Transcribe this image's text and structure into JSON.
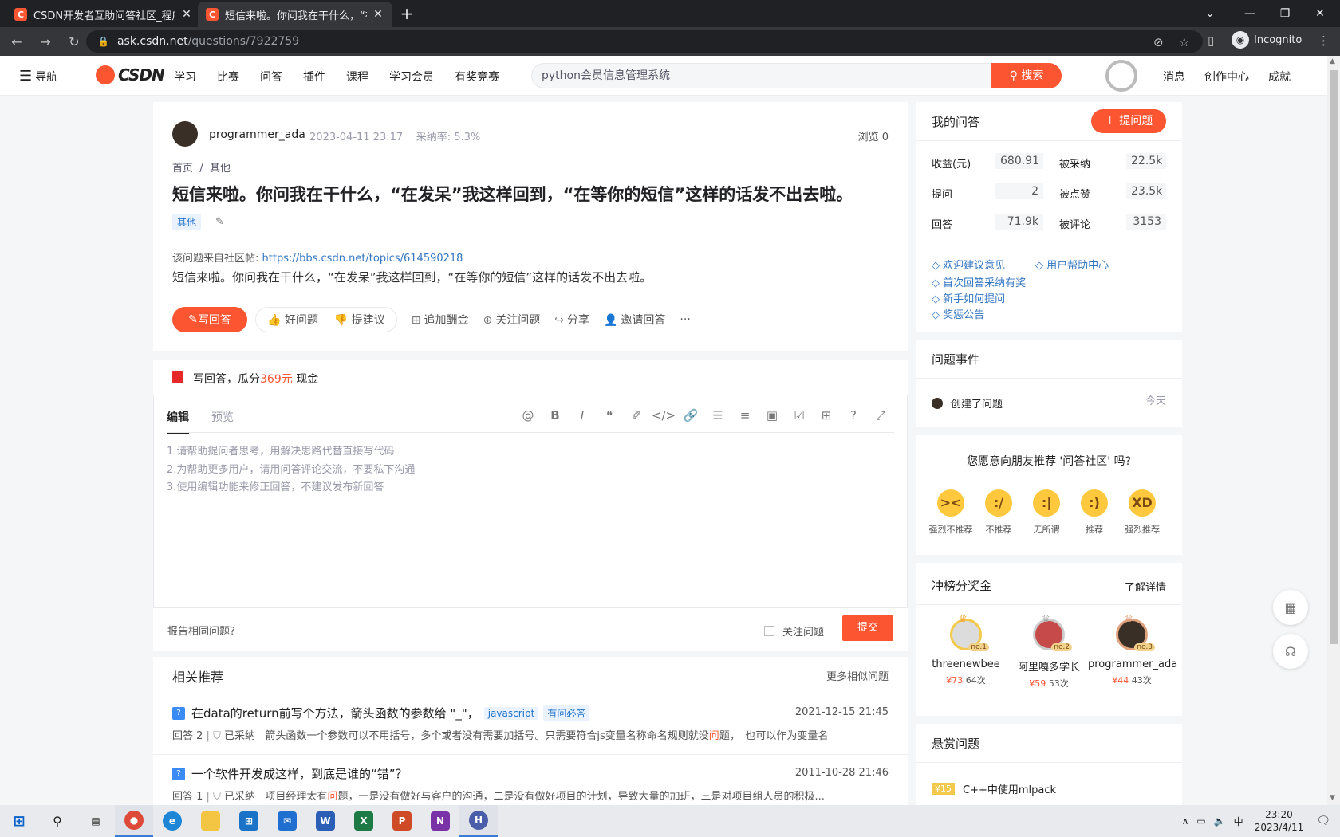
{
  "browser": {
    "tabs": [
      {
        "title": "CSDN开发者互助问答社区_程序",
        "favicon": "C"
      },
      {
        "title": "短信来啦。你问我在干什么，“在",
        "favicon": "C"
      }
    ],
    "url_host": "ask.csdn.net",
    "url_path": "/questions/7922759",
    "profile": "Incognito"
  },
  "csdn": {
    "nav_label": "导航",
    "logo": "CSDN",
    "links": [
      "学习",
      "比赛",
      "问答",
      "插件",
      "课程",
      "学习会员",
      "有奖竞赛"
    ],
    "search_placeholder": "python会员信息管理系统",
    "search_button": "搜索",
    "right_links": [
      "消息",
      "创作中心",
      "成就"
    ]
  },
  "question": {
    "user": "programmer_ada",
    "date": "2023-04-11 23:17",
    "adopt_rate": "采纳率: 5.3%",
    "views": "浏览 0",
    "breadcrumb": [
      "首页",
      "/",
      "其他"
    ],
    "title": "短信来啦。你问我在干什么，“在发呆”我这样回到，“在等你的短信”这样的话发不出去啦。",
    "tag": "其他",
    "source_label": "该问题来自社区帖:",
    "source_url": "https://bbs.csdn.net/topics/614590218",
    "body": "短信来啦。你问我在干什么，“在发呆”我这样回到，“在等你的短信”这样的话发不出去啦。",
    "actions": {
      "write": "写回答",
      "good": "好问题",
      "suggest": "提建议",
      "add_bounty": "追加酬金",
      "follow": "关注问题",
      "share": "分享",
      "invite": "邀请回答",
      "more": "···"
    }
  },
  "bonus": {
    "prefix": "写回答，瓜分",
    "amount": "369元",
    "suffix": "现金"
  },
  "editor": {
    "tab_edit": "编辑",
    "tab_preview": "预览",
    "placeholder_lines": [
      "1.请帮助提问者思考，用解决思路代替直接写代码",
      "2.为帮助更多用户，请用问答评论交流，不要私下沟通",
      "3.使用编辑功能来修正回答，不建议发布新回答"
    ],
    "tools": [
      "at-icon",
      "bold-icon",
      "italic-icon",
      "quote-icon",
      "brush-icon",
      "code-icon",
      "link-icon",
      "ul-icon",
      "ol-icon",
      "image-icon",
      "task-icon",
      "table-icon",
      "help-icon",
      "fullscreen-icon"
    ]
  },
  "submit": {
    "report": "报告相同问题?",
    "follow": "关注问题",
    "submit": "提交"
  },
  "related": {
    "title": "相关推荐",
    "more": "更多相似问题",
    "items": [
      {
        "title": "在data的return前写个方法，箭头函数的参数给 \"_\"，",
        "tags": [
          "javascript",
          "有问必答"
        ],
        "date": "2021-12-15 21:45",
        "answers": "回答 2",
        "adopted": "已采纳",
        "snippet_a": "箭头函数一个参数可以不用括号，多个或者没有需要加括号。只需要符合js变量名称命名规则就没",
        "snippet_hl": "问",
        "snippet_b": "题，_也可以作为变量名"
      },
      {
        "title": "一个软件开发成这样，到底是谁的“错”？",
        "tags": [],
        "date": "2011-10-28 21:46",
        "answers": "回答 1",
        "adopted": "已采纳",
        "snippet_a": "项目经理太有",
        "snippet_hl": "问",
        "snippet_b": "题，一是没有做好与客户的沟通，二是没有做好项目的计划，导致大量的加班，三是对项目组人员的积极..."
      }
    ]
  },
  "my_answers": {
    "title": "我的问答",
    "ask_button": "提问题",
    "stats": [
      {
        "label": "收益(元)",
        "value": "680.91"
      },
      {
        "label": "被采纳",
        "value": "22.5k"
      },
      {
        "label": "提问",
        "value": "2"
      },
      {
        "label": "被点赞",
        "value": "23.5k"
      },
      {
        "label": "回答",
        "value": "71.9k"
      },
      {
        "label": "被评论",
        "value": "3153"
      }
    ],
    "links": [
      "欢迎建议意见",
      "用户帮助中心",
      "首次回答采纳有奖",
      "新手如何提问",
      "奖惩公告"
    ]
  },
  "events": {
    "title": "问题事件",
    "event": "创建了问题",
    "when": "今天"
  },
  "recommend": {
    "question": "您愿意向朋友推荐 '问答社区' 吗?",
    "options": [
      "强烈不推荐",
      "不推荐",
      "无所谓",
      "推荐",
      "强烈推荐"
    ]
  },
  "rank": {
    "title": "冲榜分奖金",
    "details": "了解详情",
    "users": [
      {
        "name": "threenewbee",
        "no": "no.1",
        "money": "¥73",
        "times": "64次"
      },
      {
        "name": "阿里嘎多学长",
        "no": "no.2",
        "money": "¥59",
        "times": "53次"
      },
      {
        "name": "programmer_ada",
        "no": "no.3",
        "money": "¥44",
        "times": "43次"
      }
    ]
  },
  "bounty": {
    "title": "悬赏问题",
    "tag": "¥15",
    "item": "C++中使用mlpack"
  },
  "taskbar": {
    "apps": [
      "start",
      "search",
      "taskview",
      "chrome",
      "edge",
      "explorer",
      "store",
      "mail",
      "word",
      "excel",
      "powerpoint",
      "onenote",
      "app"
    ],
    "time": "23:20",
    "date": "2023/4/11",
    "ime": "中"
  }
}
